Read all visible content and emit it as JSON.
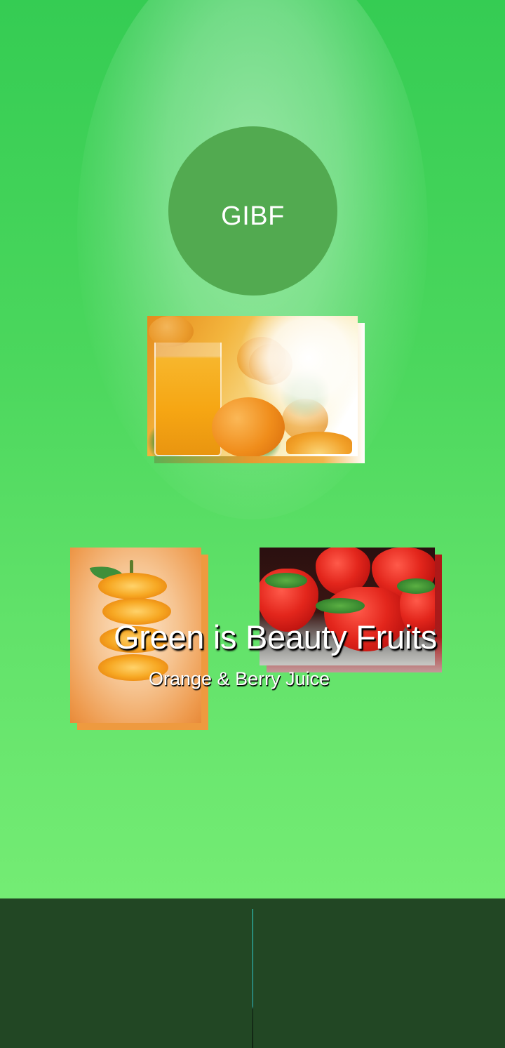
{
  "logo": {
    "text": "GIBF"
  },
  "hero": {
    "tagline": "Green is Beauty Fruits",
    "subtitle": "Orange & Berry Juice"
  },
  "images": [
    {
      "name": "orange-juice-photo",
      "subject": "glass of orange juice with oranges"
    },
    {
      "name": "sliced-orange-photo",
      "subject": "floating orange slices"
    },
    {
      "name": "strawberries-photo",
      "subject": "fresh strawberries"
    }
  ],
  "colors": {
    "hero_top": "#35cc53",
    "hero_bottom": "#74ec74",
    "logo_circle": "#52aa50",
    "footer": "#224724",
    "divider": "#2fd9d2"
  }
}
